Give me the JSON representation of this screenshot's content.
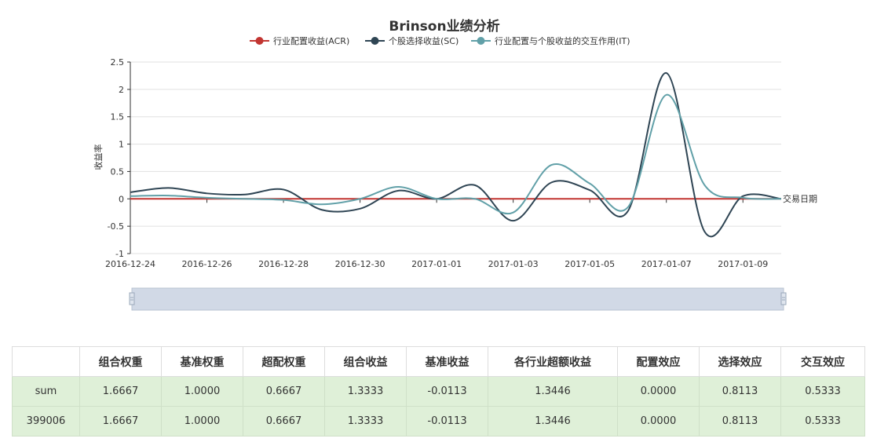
{
  "chart_data": {
    "type": "line",
    "title": "Brinson业绩分析",
    "ylabel": "收益率",
    "xlabel": "交易日期",
    "ylim": [
      -1,
      2.5
    ],
    "yticks": [
      "2.5",
      "2",
      "1.5",
      "1",
      "0.5",
      "0",
      "-0.5",
      "-1"
    ],
    "xticks": [
      "2016-12-24",
      "2016-12-26",
      "2016-12-28",
      "2016-12-30",
      "2017-01-01",
      "2017-01-03",
      "2017-01-05",
      "2017-01-07",
      "2017-01-09"
    ],
    "x": [
      "2016-12-24",
      "2016-12-25",
      "2016-12-26",
      "2016-12-27",
      "2016-12-28",
      "2016-12-29",
      "2016-12-30",
      "2016-12-31",
      "2017-01-01",
      "2017-01-02",
      "2017-01-03",
      "2017-01-04",
      "2017-01-05",
      "2017-01-06",
      "2017-01-07",
      "2017-01-08",
      "2017-01-09",
      "2017-01-10"
    ],
    "series": [
      {
        "name": "行业配置收益(ACR)",
        "color": "#c23531",
        "values": [
          0,
          0,
          0,
          0,
          0,
          0,
          0,
          0,
          0,
          0,
          0,
          0,
          0,
          0,
          0,
          0,
          0,
          0
        ]
      },
      {
        "name": "个股选择收益(SC)",
        "color": "#2f4554",
        "values": [
          0.12,
          0.2,
          0.1,
          0.08,
          0.17,
          -0.2,
          -0.18,
          0.15,
          0.0,
          0.25,
          -0.4,
          0.3,
          0.16,
          -0.22,
          2.3,
          -0.6,
          0.05,
          0.0
        ]
      },
      {
        "name": "行业配置与个股收益的交互作用(IT)",
        "color": "#61a0a8",
        "values": [
          0.05,
          0.06,
          0.02,
          0.0,
          -0.02,
          -0.1,
          0.0,
          0.22,
          0.0,
          0.0,
          -0.25,
          0.62,
          0.28,
          -0.15,
          1.9,
          0.25,
          0.02,
          0.0
        ]
      }
    ]
  },
  "table": {
    "headers": [
      "",
      "组合权重",
      "基准权重",
      "超配权重",
      "组合收益",
      "基准收益",
      "各行业超额收益",
      "配置效应",
      "选择效应",
      "交互效应"
    ],
    "rows": [
      [
        "sum",
        "1.6667",
        "1.0000",
        "0.6667",
        "1.3333",
        "-0.0113",
        "1.3446",
        "0.0000",
        "0.8113",
        "0.5333"
      ],
      [
        "399006",
        "1.6667",
        "1.0000",
        "0.6667",
        "1.3333",
        "-0.0113",
        "1.3446",
        "0.0000",
        "0.8113",
        "0.5333"
      ]
    ]
  }
}
